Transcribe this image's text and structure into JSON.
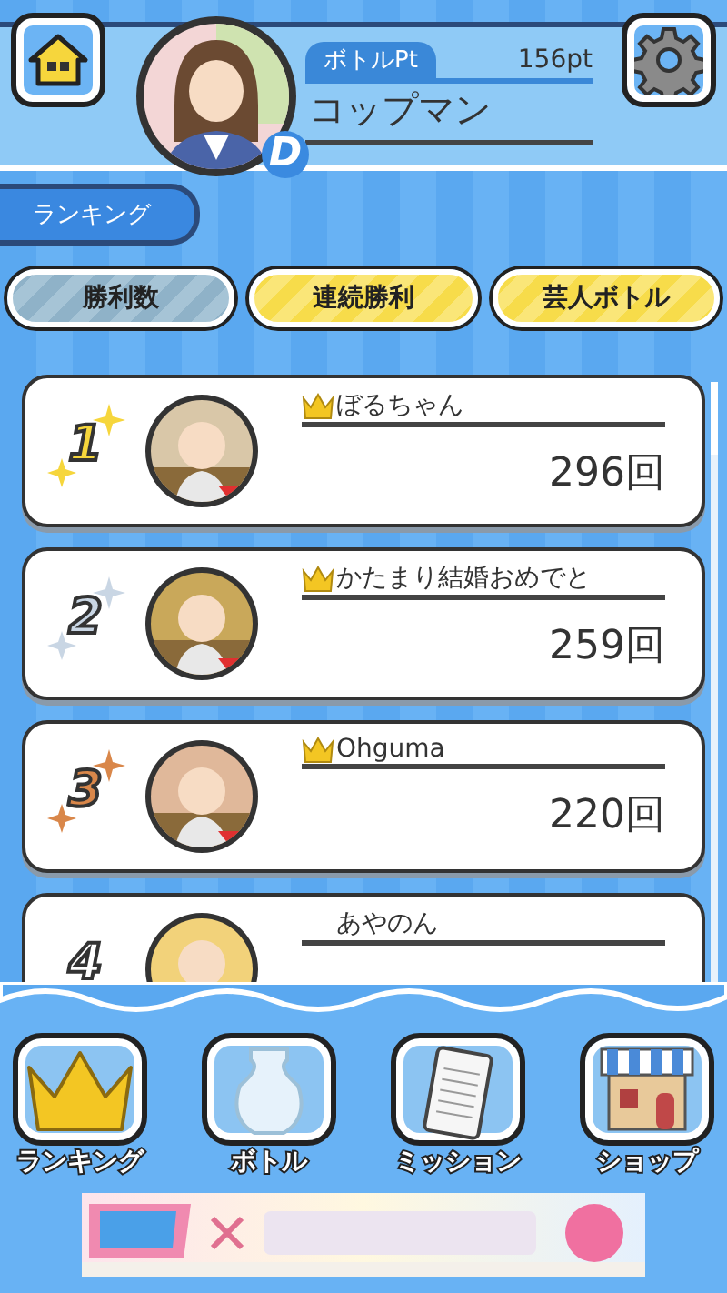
{
  "header": {
    "points_label": "ボトルPt",
    "points": "156pt",
    "user_name": "コップマン",
    "user_rank": "D"
  },
  "section_title": "ランキング",
  "tabs": [
    {
      "label": "勝利数",
      "selected": true
    },
    {
      "label": "連続勝利",
      "selected": false
    },
    {
      "label": "芸人ボトル",
      "selected": false
    }
  ],
  "ranking": [
    {
      "rank": "1",
      "kind": "gold",
      "crown": true,
      "name": "ぼるちゃん",
      "score": "296回"
    },
    {
      "rank": "2",
      "kind": "silver",
      "crown": true,
      "name": "かたまり結婚おめでと",
      "score": "259回"
    },
    {
      "rank": "3",
      "kind": "bronze",
      "crown": true,
      "name": "Ohguma",
      "score": "220回"
    },
    {
      "rank": "4",
      "kind": "plain",
      "crown": false,
      "name": "あやのん"
    }
  ],
  "nav": [
    {
      "label": "ランキング",
      "kind": "crown"
    },
    {
      "label": "ボトル",
      "kind": "vase"
    },
    {
      "label": "ミッション",
      "kind": "clipboard"
    },
    {
      "label": "ショップ",
      "kind": "shop"
    }
  ]
}
